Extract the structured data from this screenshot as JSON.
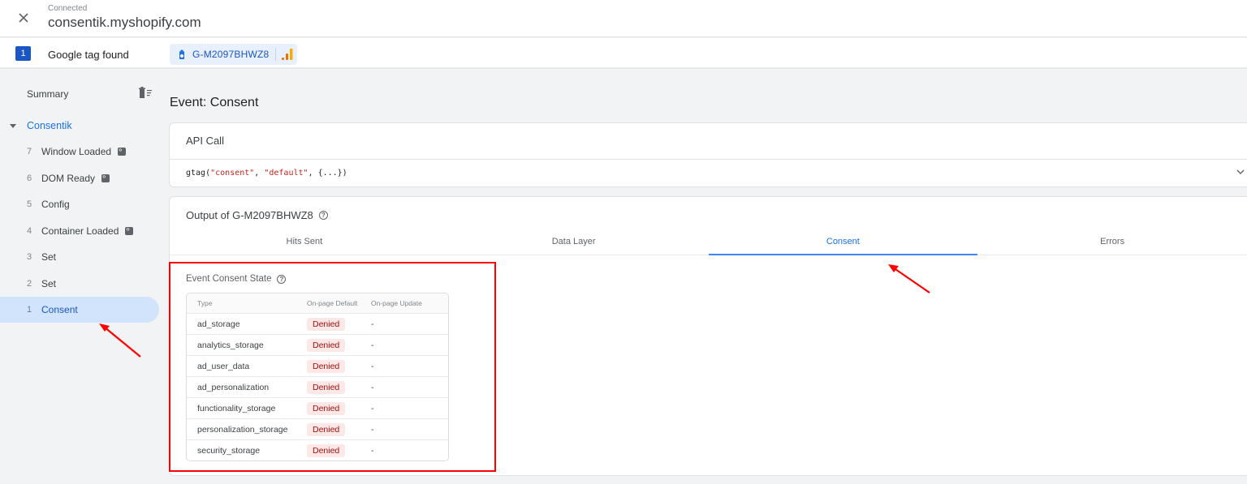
{
  "header": {
    "close_icon": "close-icon",
    "connection_status": "Connected",
    "domain": "consentik.myshopify.com"
  },
  "tag_bar": {
    "count": "1",
    "found_label": "Google tag found",
    "tag_id": "G-M2097BHWZ8",
    "tag_icon": "google-tag-icon",
    "analytics_icon": "analytics-icon"
  },
  "sidebar": {
    "summary_label": "Summary",
    "clear_icon": "delete-list-icon",
    "container_name": "Consentik",
    "items": [
      {
        "num": "7",
        "label": "Window Loaded",
        "has_code_icon": true
      },
      {
        "num": "6",
        "label": "DOM Ready",
        "has_code_icon": true
      },
      {
        "num": "5",
        "label": "Config",
        "has_code_icon": false
      },
      {
        "num": "4",
        "label": "Container Loaded",
        "has_code_icon": true
      },
      {
        "num": "3",
        "label": "Set",
        "has_code_icon": false
      },
      {
        "num": "2",
        "label": "Set",
        "has_code_icon": false
      },
      {
        "num": "1",
        "label": "Consent",
        "has_code_icon": false,
        "active": true
      }
    ]
  },
  "main": {
    "event_title": "Event: Consent",
    "api_call": {
      "title": "API Call",
      "code_fn": "gtag(",
      "code_arg1": "\"consent\"",
      "code_sep1": ", ",
      "code_arg2": "\"default\"",
      "code_rest": ", {...})"
    },
    "output": {
      "title": "Output of G-M2097BHWZ8",
      "tabs": [
        {
          "label": "Hits Sent",
          "active": false
        },
        {
          "label": "Data Layer",
          "active": false
        },
        {
          "label": "Consent",
          "active": true
        },
        {
          "label": "Errors",
          "active": false
        }
      ],
      "consent_state": {
        "title": "Event Consent State",
        "columns": [
          "Type",
          "On-page Default",
          "On-page Update"
        ],
        "rows": [
          {
            "type": "ad_storage",
            "default": "Denied",
            "update": "-"
          },
          {
            "type": "analytics_storage",
            "default": "Denied",
            "update": "-"
          },
          {
            "type": "ad_user_data",
            "default": "Denied",
            "update": "-"
          },
          {
            "type": "ad_personalization",
            "default": "Denied",
            "update": "-"
          },
          {
            "type": "functionality_storage",
            "default": "Denied",
            "update": "-"
          },
          {
            "type": "personalization_storage",
            "default": "Denied",
            "update": "-"
          },
          {
            "type": "security_storage",
            "default": "Denied",
            "update": "-"
          }
        ]
      }
    }
  },
  "colors": {
    "accent": "#1a73e8",
    "active_bg": "#d2e3fc",
    "denied_bg": "#fce8e6",
    "denied_text": "#a50e0e",
    "annotation": "#ff0000"
  }
}
